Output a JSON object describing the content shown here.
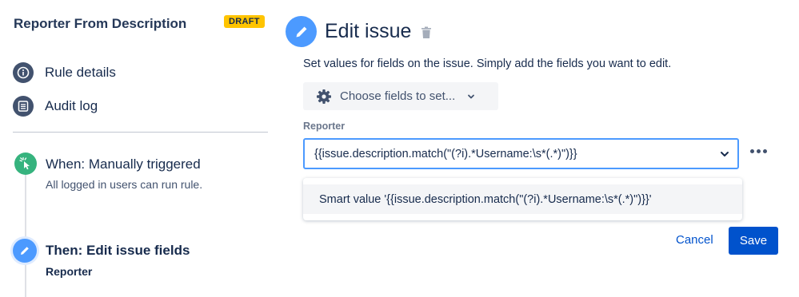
{
  "sidebar": {
    "rule_name": "Reporter From Description",
    "status_badge": "DRAFT",
    "nav": [
      {
        "label": "Rule details",
        "icon": "info-icon"
      },
      {
        "label": "Audit log",
        "icon": "list-icon"
      }
    ],
    "steps": [
      {
        "title": "When: Manually triggered",
        "subtitle": "All logged in users can run rule.",
        "icon": "cursor-click-icon",
        "color": "#36B37E"
      },
      {
        "title": "Then: Edit issue fields",
        "subtitle": "Reporter",
        "icon": "pencil-icon",
        "color": "#4C9AFF"
      }
    ]
  },
  "main": {
    "title": "Edit issue",
    "description": "Set values for fields on the issue. Simply add the fields you want to edit.",
    "choose_fields_label": "Choose fields to set...",
    "field": {
      "label": "Reporter",
      "value": "{{issue.description.match(\"(?i).*Username:\\s*(.*)\")}}",
      "suggestion": "Smart value '{{issue.description.match(\"(?i).*Username:\\s*(.*)\")}}'"
    },
    "buttons": {
      "cancel": "Cancel",
      "save": "Save"
    }
  },
  "colors": {
    "primary": "#0052CC",
    "draft_badge": "#FFC400",
    "focus_border": "#4C9AFF"
  }
}
